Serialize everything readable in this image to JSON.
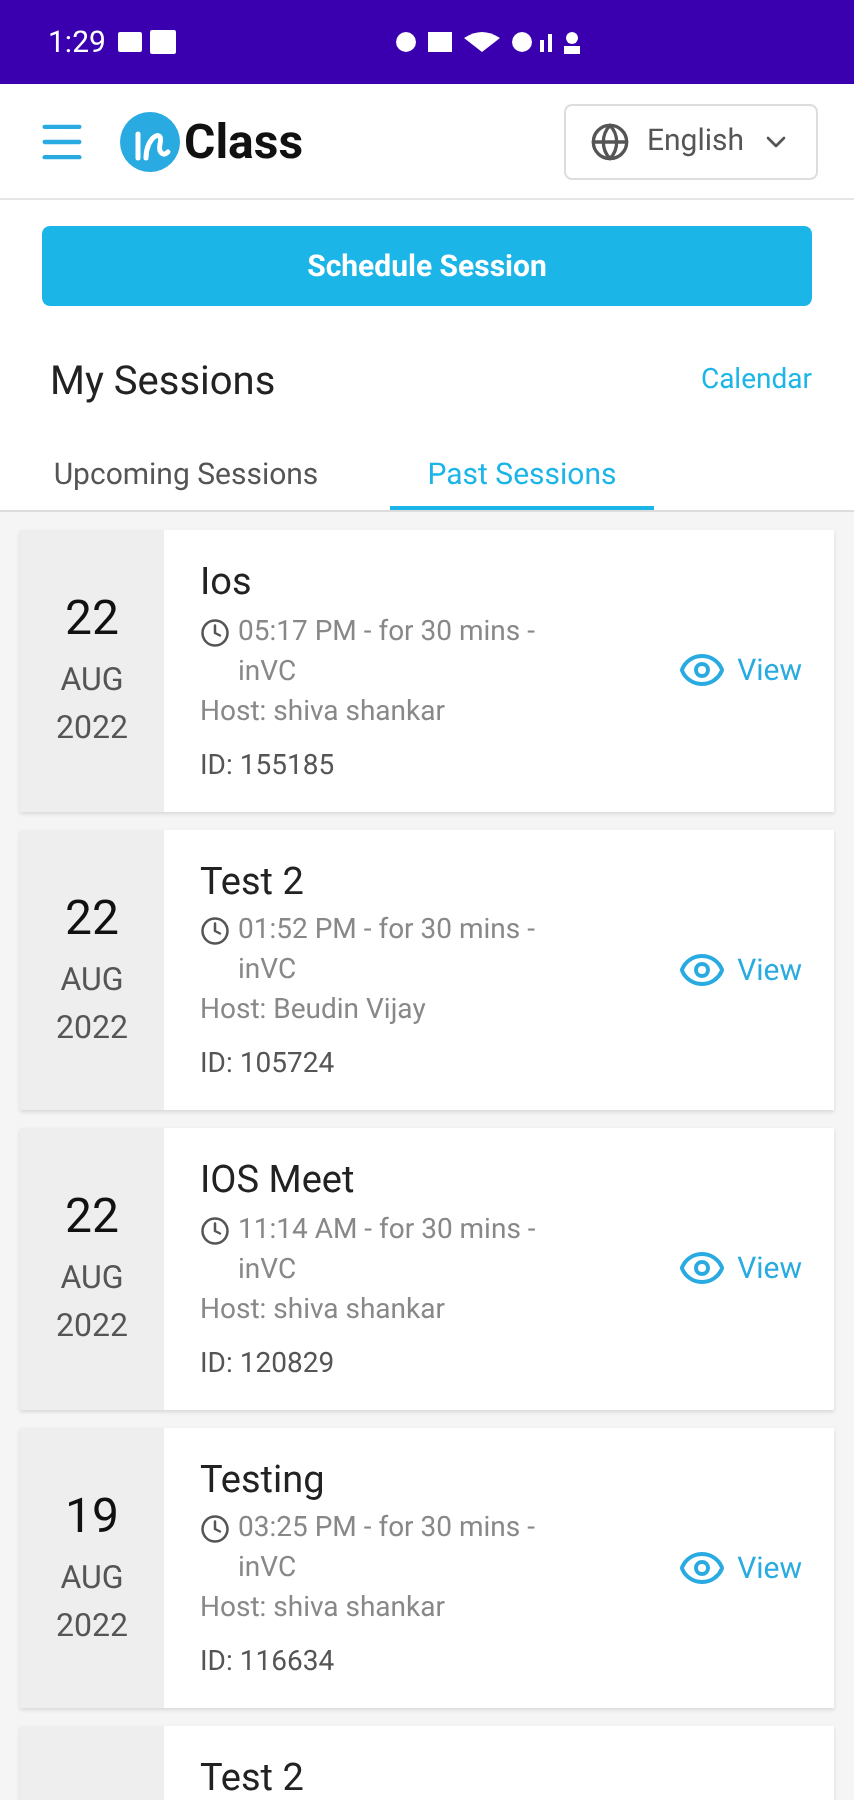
{
  "status_bar": {
    "time": "1:29"
  },
  "header": {
    "app_name": "Class",
    "language": "English"
  },
  "schedule_button": "Schedule Session",
  "section": {
    "title": "My Sessions",
    "link": "Calendar"
  },
  "tabs": [
    {
      "label": "Upcoming Sessions",
      "selected": false
    },
    {
      "label": "Past Sessions",
      "selected": true
    }
  ],
  "sessions": [
    {
      "day": "22",
      "month": "AUG",
      "year": "2022",
      "title": "Ios",
      "time": "05:17 PM - for 30 mins - inVC",
      "host": "Host: shiva shankar",
      "id": "ID: 155185",
      "action": "View"
    },
    {
      "day": "22",
      "month": "AUG",
      "year": "2022",
      "title": "Test 2",
      "time": "01:52 PM - for 30 mins - inVC",
      "host": "Host: Beudin Vijay",
      "id": "ID: 105724",
      "action": "View"
    },
    {
      "day": "22",
      "month": "AUG",
      "year": "2022",
      "title": "IOS Meet",
      "time": "11:14 AM - for 30 mins - inVC",
      "host": "Host: shiva shankar",
      "id": "ID: 120829",
      "action": "View"
    },
    {
      "day": "19",
      "month": "AUG",
      "year": "2022",
      "title": "Testing",
      "time": "03:25 PM - for 30 mins - inVC",
      "host": "Host: shiva shankar",
      "id": "ID: 116634",
      "action": "View"
    },
    {
      "title": "Test 2"
    }
  ]
}
